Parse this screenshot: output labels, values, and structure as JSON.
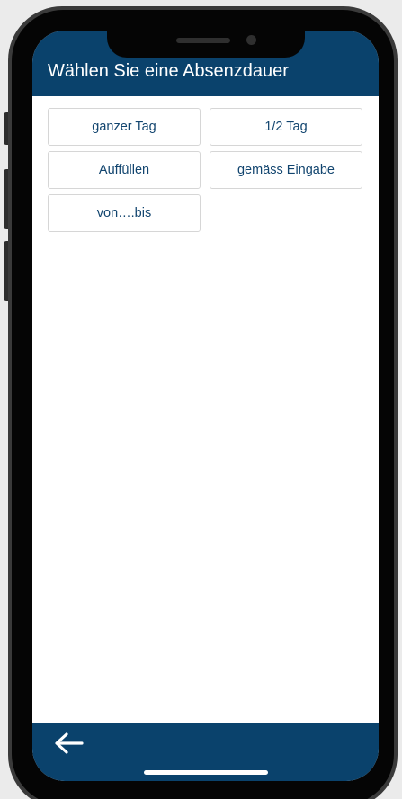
{
  "header": {
    "title": "Wählen Sie eine Absenzdauer"
  },
  "options": [
    {
      "label": "ganzer Tag"
    },
    {
      "label": "1/2 Tag"
    },
    {
      "label": "Auffüllen"
    },
    {
      "label": "gemäss Eingabe"
    },
    {
      "label": "von….bis"
    }
  ],
  "footer": {
    "back_icon": "arrow-left-icon"
  },
  "colors": {
    "primary": "#0a426c",
    "button_text": "#12456f",
    "button_border": "#d6d6d6"
  }
}
